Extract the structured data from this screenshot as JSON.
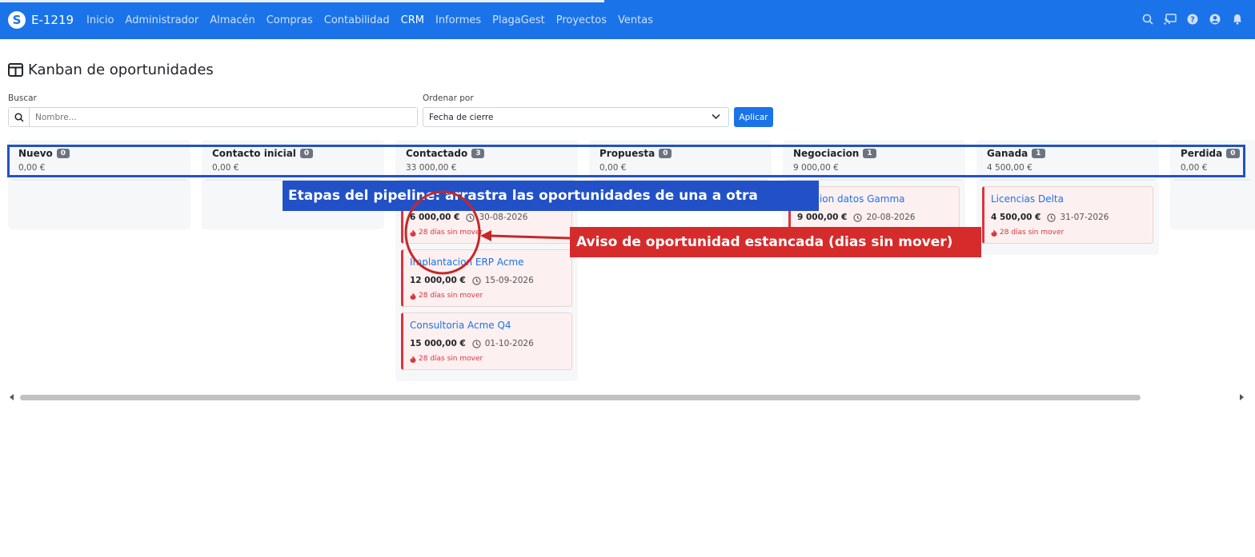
{
  "app": {
    "name": "E-1219"
  },
  "nav": {
    "items": [
      "Inicio",
      "Administrador",
      "Almacén",
      "Compras",
      "Contabilidad",
      "CRM",
      "Informes",
      "PlagaGest",
      "Proyectos",
      "Ventas"
    ],
    "active": "CRM"
  },
  "page": {
    "title": "Kanban de oportunidades"
  },
  "filters": {
    "search_label": "Buscar",
    "search_placeholder": "Nombre...",
    "order_label": "Ordenar por",
    "order_value": "Fecha de cierre",
    "apply_label": "Aplicar"
  },
  "columns": [
    {
      "name": "Nuevo",
      "count": "0",
      "sum": "0,00 €"
    },
    {
      "name": "Contacto inicial",
      "count": "0",
      "sum": "0,00 €"
    },
    {
      "name": "Contactado",
      "count": "3",
      "sum": "33 000,00 €"
    },
    {
      "name": "Propuesta",
      "count": "0",
      "sum": "0,00 €"
    },
    {
      "name": "Negociacion",
      "count": "1",
      "sum": "9 000,00 €"
    },
    {
      "name": "Ganada",
      "count": "1",
      "sum": "4 500,00 €"
    },
    {
      "name": "Perdida",
      "count": "0",
      "sum": "0,00 €"
    }
  ],
  "cards": {
    "contactado": [
      {
        "title": "",
        "amount": "6 000,00 €",
        "date": "30-08-2026",
        "stale": "28 días sin mover"
      },
      {
        "title": "Implantacion ERP Acme",
        "amount": "12 000,00 €",
        "date": "15-09-2026",
        "stale": "28 días sin mover"
      },
      {
        "title": "Consultoria Acme Q4",
        "amount": "15 000,00 €",
        "date": "01-10-2026",
        "stale": "28 días sin mover"
      }
    ],
    "negociacion": [
      {
        "title": "acion datos Gamma",
        "amount": "9 000,00 €",
        "date": "20-08-2026",
        "stale": ""
      }
    ],
    "ganada": [
      {
        "title": "Licencias Delta",
        "amount": "4 500,00 €",
        "date": "31-07-2026",
        "stale": "28 días sin mover"
      }
    ]
  },
  "annotations": {
    "stages": "Etapas del pipeline: arrastra las oportunidades de una a otra",
    "stale": "Aviso de oportunidad estancada (dias sin mover)"
  },
  "colors": {
    "primary": "#1a73e8",
    "danger": "#d9363e",
    "annotation_blue": "#2251c7",
    "annotation_red": "#d62b2b"
  }
}
